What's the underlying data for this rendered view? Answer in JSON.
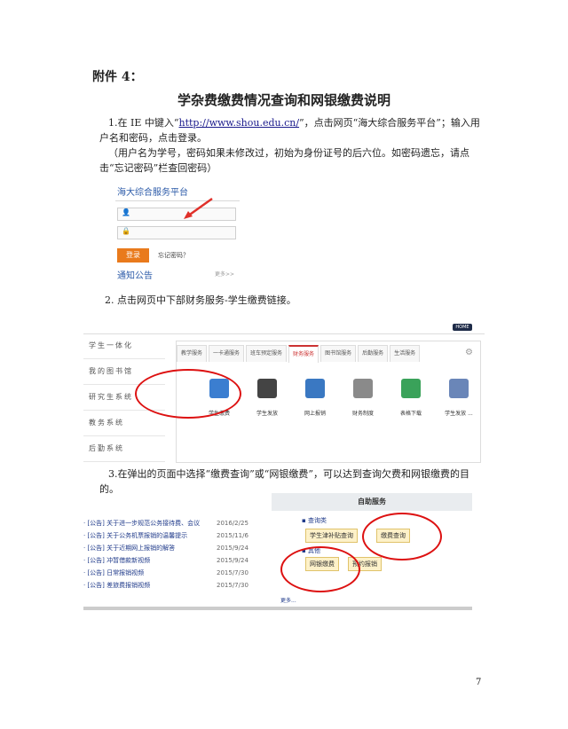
{
  "heading": "附件 4：",
  "title": "学杂费缴费情况查询和网银缴费说明",
  "step1": {
    "prefix": "1.在 IE 中键入“",
    "url": "http://www.shou.edu.cn/",
    "suffix": "”，点击网页“海大综合服务平台”；输入用户名和密码，点击登录。",
    "note": "（用户名为学号，密码如果未修改过，初始为身份证号的后六位。如密码遗忘，请点击“忘记密码”栏查回密码）"
  },
  "login": {
    "platform_title": "海大综合服务平台",
    "user_icon": "person-icon",
    "lock_icon": "lock-icon",
    "login_button": "登录",
    "forgot": "忘记密码？",
    "notice": "通知公告",
    "more": "更多>>"
  },
  "step2": "2. 点击网页中下部财务服务-学生缴费链接。",
  "portal": {
    "home": "HOME",
    "sidebar": [
      "学生一体化",
      "我的图书馆",
      "研究生系统",
      "教务系统",
      "后勤系统"
    ],
    "tabs": [
      "教学服务",
      "一卡通服务",
      "班车预定服务",
      "财务服务",
      "图书馆服务",
      "后勤服务",
      "生活服务"
    ],
    "active_tab": "财务服务",
    "icons": [
      {
        "label": "学生缴费",
        "color": "#3b7ed0"
      },
      {
        "label": "学生发放",
        "color": "#444444"
      },
      {
        "label": "网上报销",
        "color": "#3a78c2"
      },
      {
        "label": "财务制度",
        "color": "#8a8a8a"
      },
      {
        "label": "表格下载",
        "color": "#3aa25a"
      },
      {
        "label": "学生发放 ...",
        "color": "#6a86b8"
      }
    ]
  },
  "step3": "3.在弹出的页面中选择“缴费查询”或“网银缴费”，可以达到查询欠费和网银缴费的目的。",
  "selfservice": {
    "header": "自助服务",
    "cat1": "▪ 查询类",
    "btn1": "学生津补贴查询",
    "btn2": "缴费查询",
    "cat2": "▪ 其他",
    "btn3": "网银缴费",
    "btn4": "预约报销",
    "more": "更多..."
  },
  "notices": [
    {
      "title": "· [公告] 关于进一步规范公务接待费、会议",
      "date": "2016/2/25"
    },
    {
      "title": "· [公告] 关于公务机票报销的温馨提示",
      "date": "2015/11/6"
    },
    {
      "title": "· [公告] 关于近期网上报销的解答",
      "date": "2015/9/24"
    },
    {
      "title": "· [公告] 冲暂借款新视频",
      "date": "2015/9/24"
    },
    {
      "title": "· [公告] 日常报销视频",
      "date": "2015/7/30"
    },
    {
      "title": "· [公告] 差旅费报销视频",
      "date": "2015/7/30"
    }
  ],
  "page_number": "7"
}
